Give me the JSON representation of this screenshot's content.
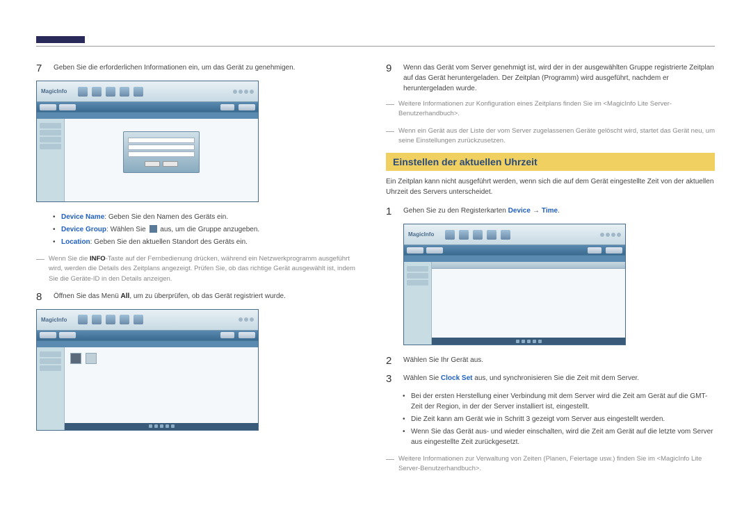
{
  "left": {
    "step7": {
      "num": "7",
      "text": "Geben Sie die erforderlichen Informationen ein, um das Gerät zu genehmigen."
    },
    "bullets": [
      {
        "label": "Device Name",
        "text": ": Geben Sie den Namen des Geräts ein."
      },
      {
        "label": "Device Group",
        "text_pre": ": Wählen Sie ",
        "text_post": " aus, um die Gruppe anzugeben."
      },
      {
        "label": "Location",
        "text": ": Geben Sie den aktuellen Standort des Geräts ein."
      }
    ],
    "note7": {
      "pre": "Wenn Sie die ",
      "info": "INFO",
      "post": "-Taste auf der Fernbedienung drücken, während ein Netzwerkprogramm ausgeführt wird, werden die Details des Zeitplans angezeigt. Prüfen Sie, ob das richtige Gerät ausgewählt ist, indem Sie die Geräte-ID in den Details anzeigen."
    },
    "step8": {
      "num": "8",
      "text_pre": "Öffnen Sie das Menü ",
      "all": "All",
      "text_post": ", um zu überprüfen, ob das Gerät registriert wurde."
    }
  },
  "right": {
    "step9": {
      "num": "9",
      "text": "Wenn das Gerät vom Server genehmigt ist, wird der in der ausgewählten Gruppe registrierte Zeitplan auf das Gerät heruntergeladen. Der Zeitplan (Programm) wird ausgeführt, nachdem er heruntergeladen wurde."
    },
    "note9a": "Weitere Informationen zur Konfiguration eines Zeitplans finden Sie im <MagicInfo Lite Server-Benutzerhandbuch>.",
    "note9b": "Wenn ein Gerät aus der Liste der vom Server zugelassenen Geräte gelöscht wird, startet das Gerät neu, um seine Einstellungen zurückzusetzen.",
    "heading": "Einstellen der aktuellen Uhrzeit",
    "intro": "Ein Zeitplan kann nicht ausgeführt werden, wenn sich die auf dem Gerät eingestellte Zeit von der aktuellen Uhrzeit des Servers unterscheidet.",
    "step1": {
      "num": "1",
      "text_pre": "Gehen Sie zu den Registerkarten ",
      "device": "Device",
      "arrow": "→",
      "time": "Time",
      "text_post": "."
    },
    "step2": {
      "num": "2",
      "text": "Wählen Sie Ihr Gerät aus."
    },
    "step3": {
      "num": "3",
      "text_pre": "Wählen Sie ",
      "clock": "Clock Set",
      "text_post": " aus, und synchronisieren Sie die Zeit mit dem Server."
    },
    "bullets3": [
      "Bei der ersten Herstellung einer Verbindung mit dem Server wird die Zeit am Gerät auf die GMT-Zeit der Region, in der der Server installiert ist, eingestellt.",
      "Die Zeit kann am Gerät wie in Schritt 3 gezeigt vom Server aus eingestellt werden.",
      "Wenn Sie das Gerät aus- und wieder einschalten, wird die Zeit am Gerät auf die letzte vom Server aus eingestellte Zeit zurückgesetzt."
    ],
    "note3": "Weitere Informationen zur Verwaltung von Zeiten (Planen, Feiertage usw.) finden Sie im <MagicInfo Lite Server-Benutzerhandbuch>."
  },
  "screenshot_logo": "MagicInfo"
}
